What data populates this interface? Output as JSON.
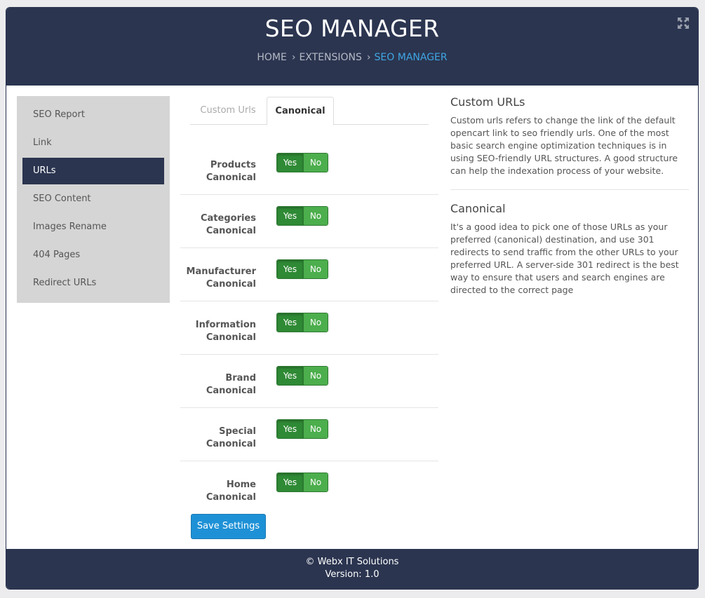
{
  "header": {
    "title": "SEO MANAGER",
    "breadcrumb": [
      "HOME",
      "EXTENSIONS",
      "SEO MANAGER"
    ],
    "separator": "›",
    "expand_icon": "expand-icon"
  },
  "sidebar": {
    "items": [
      {
        "label": "SEO Report",
        "active": false
      },
      {
        "label": "Link",
        "active": false
      },
      {
        "label": "URLs",
        "active": true
      },
      {
        "label": "SEO Content",
        "active": false
      },
      {
        "label": "Images Rename",
        "active": false
      },
      {
        "label": "404 Pages",
        "active": false
      },
      {
        "label": "Redirect URLs",
        "active": false
      }
    ]
  },
  "tabs": [
    {
      "label": "Custom Urls",
      "active": false
    },
    {
      "label": "Canonical",
      "active": true
    }
  ],
  "settings": [
    {
      "line1": "Products",
      "line2": "Canonical",
      "yes": "Yes",
      "no": "No",
      "value": "Yes"
    },
    {
      "line1": "Categories",
      "line2": "Canonical",
      "yes": "Yes",
      "no": "No",
      "value": "Yes"
    },
    {
      "line1": "Manufacturer",
      "line2": "Canonical",
      "yes": "Yes",
      "no": "No",
      "value": "Yes"
    },
    {
      "line1": "Information",
      "line2": "Canonical",
      "yes": "Yes",
      "no": "No",
      "value": "Yes"
    },
    {
      "line1": "Brand",
      "line2": "Canonical",
      "yes": "Yes",
      "no": "No",
      "value": "Yes"
    },
    {
      "line1": "Special",
      "line2": "Canonical",
      "yes": "Yes",
      "no": "No",
      "value": "Yes"
    },
    {
      "line1": "Home",
      "line2": "Canonical",
      "yes": "Yes",
      "no": "No",
      "value": "Yes"
    }
  ],
  "save_label": "Save Settings",
  "info": {
    "sections": [
      {
        "title": "Custom URLs",
        "text": "Custom urls refers to change the link of the default opencart link to seo friendly urls. One of the most basic search engine optimization techniques is in using SEO-friendly URL structures. A good structure can help the indexation process of your website."
      },
      {
        "title": "Canonical",
        "text": "It's a good idea to pick one of those URLs as your preferred (canonical) destination, and use 301 redirects to send traffic from the other URLs to your preferred URL. A server-side 301 redirect is the best way to ensure that users and search engines are directed to the correct page"
      }
    ]
  },
  "footer": {
    "line1": "© Webx IT Solutions",
    "line2": "Version: 1.0"
  },
  "colors": {
    "header_bg": "#2b3550",
    "accent": "#3fa6e3",
    "toggle_yes": "#2f8a35",
    "toggle_no": "#4cae4c",
    "save_button": "#1e91d6"
  }
}
